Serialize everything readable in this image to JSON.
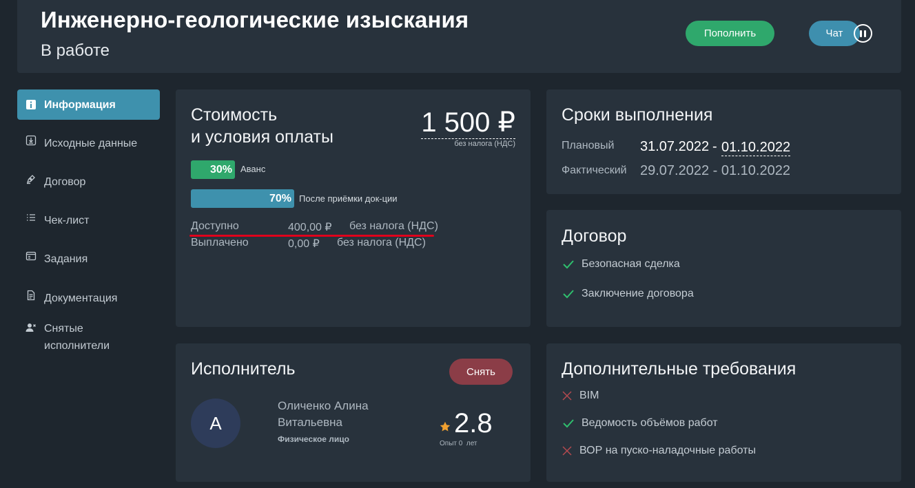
{
  "header": {
    "title": "Инженерно-геологические изыскания",
    "status": "В работе",
    "topup_label": "Пополнить",
    "chat_label": "Чат"
  },
  "sidebar": {
    "items": [
      {
        "label": "Информация",
        "icon": "info-icon"
      },
      {
        "label": "Исходные данные",
        "icon": "download-box-icon"
      },
      {
        "label": "Договор",
        "icon": "pen-icon"
      },
      {
        "label": "Чек-лист",
        "icon": "checklist-icon"
      },
      {
        "label": "Задания",
        "icon": "tasks-icon"
      },
      {
        "label": "Документация",
        "icon": "document-icon"
      },
      {
        "label": "Снятые исполнители",
        "icon": "user-remove-icon"
      }
    ]
  },
  "cost": {
    "title_line1": "Стоимость",
    "title_line2": "и условия оплаты",
    "price": "1 500 ₽",
    "price_note": "без налога (НДС)",
    "advance": {
      "percent": "30%",
      "value": 0.3,
      "label": "Аванс",
      "color": "#2fa86c"
    },
    "after": {
      "percent": "70%",
      "value": 0.7,
      "label": "После приёмки док-ции",
      "color": "#3e91ad"
    },
    "available": {
      "label": "Доступно",
      "amount": "400,00 ₽",
      "tax": "без налога (НДС)"
    },
    "paid": {
      "label": "Выплачено",
      "amount": "0,00 ₽",
      "tax": "без налога (НДС)"
    }
  },
  "deadlines": {
    "title": "Сроки выполнения",
    "planned": {
      "label": "Плановый",
      "start": "31.07.2022",
      "dash": "-",
      "end": "01.10.2022"
    },
    "actual": {
      "label": "Фактический",
      "value": "29.07.2022 - 01.10.2022"
    }
  },
  "contract": {
    "title": "Договор",
    "items": [
      {
        "label": "Безопасная сделка",
        "status": "check"
      },
      {
        "label": "Заключение договора",
        "status": "check"
      }
    ]
  },
  "executor": {
    "title": "Исполнитель",
    "remove_label": "Снять",
    "avatar_letter": "А",
    "name_line1": "Оличенко Алина",
    "name_line2": "Витальевна",
    "type": "Физическое лицо",
    "rating": "2.8",
    "experience": "Опыт 0  лет"
  },
  "extra": {
    "title": "Дополнительные требования",
    "items": [
      {
        "label": "BIM",
        "status": "cross"
      },
      {
        "label": "Ведомость объёмов работ",
        "status": "check"
      },
      {
        "label": "ВОР на пуско-наладочные работы",
        "status": "cross"
      }
    ]
  },
  "colors": {
    "background": "#1e262e",
    "card": "#28323c",
    "green": "#2fa86c",
    "blue": "#3e91ad",
    "danger": "#8b3d47",
    "check": "#2fbf6e",
    "cross": "#b44a4f",
    "star": "#f0a030",
    "underline": "#e0001b"
  }
}
